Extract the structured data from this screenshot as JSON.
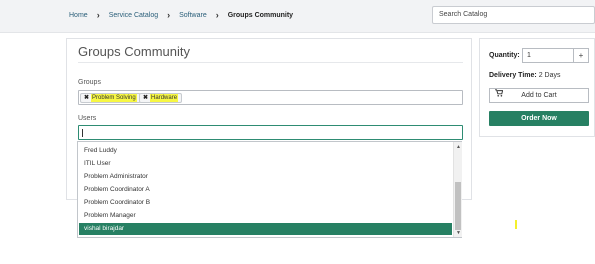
{
  "breadcrumb": {
    "home": "Home",
    "catalog": "Service Catalog",
    "category": "Software",
    "current": "Groups Community"
  },
  "search": {
    "placeholder": "Search Catalog"
  },
  "form": {
    "title": "Groups Community",
    "groups_label": "Groups",
    "groups_tags": [
      "Problem Solving",
      "Hardware"
    ],
    "users_label": "Users",
    "users_value": ""
  },
  "user_options": [
    "Fred Luddy",
    "ITIL User",
    "Problem Administrator",
    "Problem Coordinator A",
    "Problem Coordinator B",
    "Problem Manager",
    "vishal birajdar"
  ],
  "selected_user_index": 6,
  "sidebar": {
    "quantity_label": "Quantity:",
    "quantity_value": "1",
    "quantity_stepper_symbol": "+",
    "delivery_label": "Delivery Time:",
    "delivery_value": "2 Days",
    "add_to_cart": "Add to Cart",
    "order_now": "Order Now"
  },
  "colors": {
    "accent": "#278063",
    "highlight": "#f7f743"
  },
  "icons": {
    "breadcrumb_separator": "chevron-right-icon",
    "tag_remove": "close-icon",
    "cart": "cart-icon",
    "scroll_up": "chevron-up-icon",
    "scroll_down": "chevron-down-icon"
  }
}
